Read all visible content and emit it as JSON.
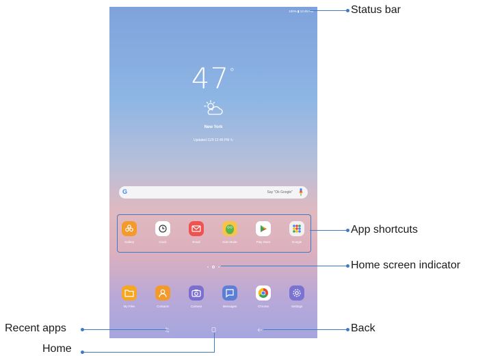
{
  "status_bar": {
    "text": "100% ▮ 12:45 PM"
  },
  "weather": {
    "temperature": "47",
    "degree_symbol": "°",
    "city": "New York",
    "updated": "Updated 11/9 12:45 PM"
  },
  "search": {
    "logo": "G",
    "hint": "Say \"Ok Google\""
  },
  "app_shortcuts": [
    {
      "label": "Gallery",
      "icon": "gallery-icon",
      "color": "#f39a2c"
    },
    {
      "label": "Clock",
      "icon": "clock-icon",
      "color": "#ffffff"
    },
    {
      "label": "Email",
      "icon": "email-icon",
      "color": "#ef5350"
    },
    {
      "label": "Kids Mode",
      "icon": "kids-mode-icon",
      "color": "#f6c44a"
    },
    {
      "label": "Play Store",
      "icon": "play-store-icon",
      "color": "#ffffff"
    },
    {
      "label": "Google",
      "icon": "google-folder-icon",
      "color": "#f1f1f1"
    }
  ],
  "dock_apps": [
    {
      "label": "My Files",
      "icon": "folder-icon",
      "color": "#f5a623"
    },
    {
      "label": "Contacts",
      "icon": "contacts-icon",
      "color": "#f39a2c"
    },
    {
      "label": "Camera",
      "icon": "camera-icon",
      "color": "#7b6fd0"
    },
    {
      "label": "Messages",
      "icon": "messages-icon",
      "color": "#5c7fd6"
    },
    {
      "label": "Chrome",
      "icon": "chrome-icon",
      "color": "#ffffff"
    },
    {
      "label": "Settings",
      "icon": "settings-icon",
      "color": "#7b73d2"
    }
  ],
  "callouts": {
    "status_bar": "Status bar",
    "app_shortcuts": "App shortcuts",
    "home_indicator": "Home screen indicator",
    "recent_apps": "Recent apps",
    "back": "Back",
    "home": "Home"
  },
  "colors": {
    "accent": "#3d7ac5"
  }
}
